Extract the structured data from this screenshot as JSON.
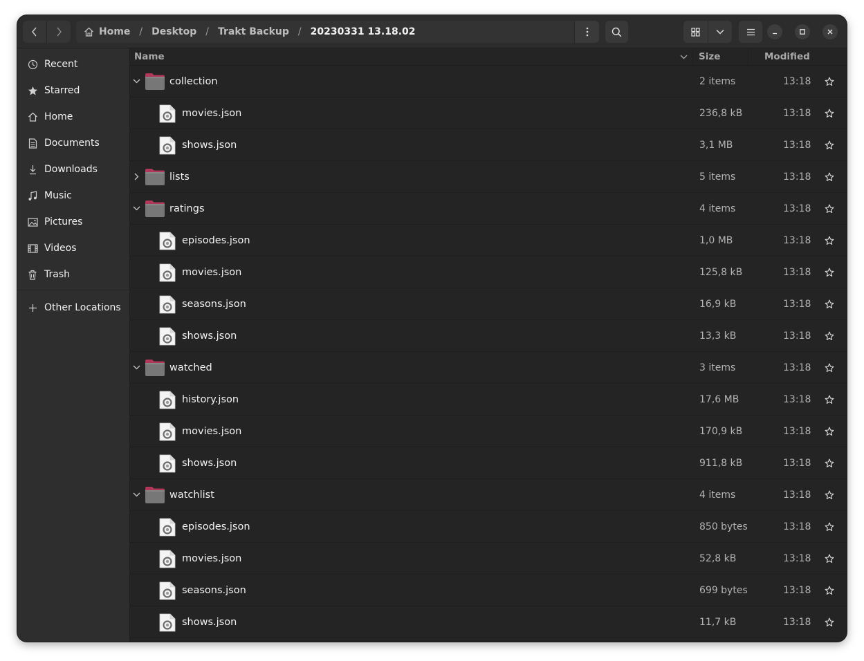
{
  "toolbar": {
    "back_icon": "chevron-left-icon",
    "forward_icon": "chevron-right-icon",
    "breadcrumb": [
      "Home",
      "Desktop",
      "Trakt Backup",
      "20230331 13.18.02"
    ],
    "separator": "/",
    "path_menu_icon": "vertical-dots-icon",
    "search_icon": "search-icon",
    "view_icon": "grid-view-icon",
    "view_dropdown_icon": "chevron-down-icon",
    "menu_icon": "hamburger-menu-icon",
    "minimize_icon": "minimize-icon",
    "maximize_icon": "maximize-icon",
    "close_icon": "close-icon"
  },
  "sidebar": {
    "items": [
      {
        "label": "Recent",
        "icon": "clock-icon"
      },
      {
        "label": "Starred",
        "icon": "star-icon"
      },
      {
        "label": "Home",
        "icon": "home-icon"
      },
      {
        "label": "Documents",
        "icon": "document-icon"
      },
      {
        "label": "Downloads",
        "icon": "download-icon"
      },
      {
        "label": "Music",
        "icon": "music-icon"
      },
      {
        "label": "Pictures",
        "icon": "picture-icon"
      },
      {
        "label": "Videos",
        "icon": "video-icon"
      },
      {
        "label": "Trash",
        "icon": "trash-icon"
      }
    ],
    "other_locations": {
      "label": "Other Locations",
      "icon": "plus-icon"
    }
  },
  "columns": {
    "name": "Name",
    "size": "Size",
    "modified": "Modified",
    "sort_icon": "chevron-down-icon"
  },
  "files": [
    {
      "name": "collection",
      "type": "folder",
      "expanded": true,
      "size": "2 items",
      "modified": "13:18"
    },
    {
      "name": "movies.json",
      "type": "file",
      "size": "236,8 kB",
      "modified": "13:18"
    },
    {
      "name": "shows.json",
      "type": "file",
      "size": "3,1 MB",
      "modified": "13:18"
    },
    {
      "name": "lists",
      "type": "folder",
      "expanded": false,
      "size": "5 items",
      "modified": "13:18"
    },
    {
      "name": "ratings",
      "type": "folder",
      "expanded": true,
      "size": "4 items",
      "modified": "13:18"
    },
    {
      "name": "episodes.json",
      "type": "file",
      "size": "1,0 MB",
      "modified": "13:18"
    },
    {
      "name": "movies.json",
      "type": "file",
      "size": "125,8 kB",
      "modified": "13:18"
    },
    {
      "name": "seasons.json",
      "type": "file",
      "size": "16,9 kB",
      "modified": "13:18"
    },
    {
      "name": "shows.json",
      "type": "file",
      "size": "13,3 kB",
      "modified": "13:18"
    },
    {
      "name": "watched",
      "type": "folder",
      "expanded": true,
      "size": "3 items",
      "modified": "13:18"
    },
    {
      "name": "history.json",
      "type": "file",
      "size": "17,6 MB",
      "modified": "13:18"
    },
    {
      "name": "movies.json",
      "type": "file",
      "size": "170,9 kB",
      "modified": "13:18"
    },
    {
      "name": "shows.json",
      "type": "file",
      "size": "911,8 kB",
      "modified": "13:18"
    },
    {
      "name": "watchlist",
      "type": "folder",
      "expanded": true,
      "size": "4 items",
      "modified": "13:18"
    },
    {
      "name": "episodes.json",
      "type": "file",
      "size": "850 bytes",
      "modified": "13:18"
    },
    {
      "name": "movies.json",
      "type": "file",
      "size": "52,8 kB",
      "modified": "13:18"
    },
    {
      "name": "seasons.json",
      "type": "file",
      "size": "699 bytes",
      "modified": "13:18"
    },
    {
      "name": "shows.json",
      "type": "file",
      "size": "11,7 kB",
      "modified": "13:18"
    }
  ],
  "colors": {
    "window_bg": "#242424",
    "sidebar_bg": "#2e2e2e",
    "headerbar_bg": "#2c2c2c",
    "folder_tab": "#b0365a",
    "folder_body": "#777777"
  }
}
